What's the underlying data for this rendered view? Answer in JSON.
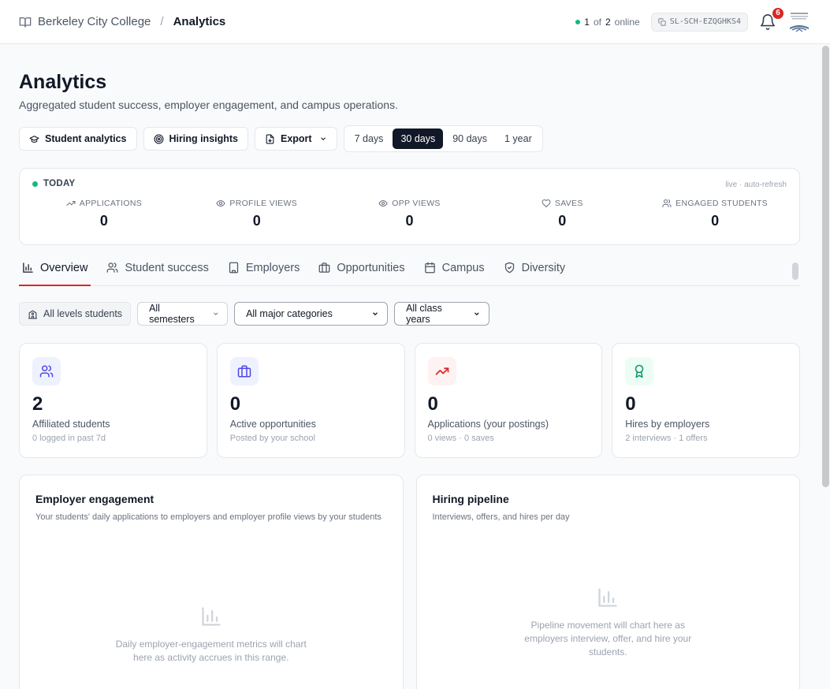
{
  "breadcrumb": {
    "org": "Berkeley City College",
    "separator": "/",
    "current": "Analytics"
  },
  "presence": {
    "count": "1",
    "of": "of",
    "total": "2",
    "label": "online"
  },
  "school_code": "SL-SCH-EZQGHKS4",
  "notifications": {
    "count": "6"
  },
  "page": {
    "title": "Analytics",
    "subtitle": "Aggregated student success, employer engagement, and campus operations."
  },
  "toolbar": {
    "student_analytics": "Student analytics",
    "hiring_insights": "Hiring insights",
    "export": "Export",
    "ranges": [
      "7 days",
      "30 days",
      "90 days",
      "1 year"
    ],
    "selected_range": "30 days"
  },
  "today": {
    "label": "TODAY",
    "live": "live · auto-refresh",
    "metrics": [
      {
        "label": "APPLICATIONS",
        "value": "0",
        "icon": "trending-up-icon"
      },
      {
        "label": "PROFILE VIEWS",
        "value": "0",
        "icon": "eye-icon"
      },
      {
        "label": "OPP VIEWS",
        "value": "0",
        "icon": "eye-icon"
      },
      {
        "label": "SAVES",
        "value": "0",
        "icon": "heart-icon"
      },
      {
        "label": "ENGAGED STUDENTS",
        "value": "0",
        "icon": "users-icon"
      }
    ]
  },
  "tabs": [
    {
      "label": "Overview",
      "icon": "bar-chart-icon",
      "active": true
    },
    {
      "label": "Student success",
      "icon": "users-icon"
    },
    {
      "label": "Employers",
      "icon": "building-icon"
    },
    {
      "label": "Opportunities",
      "icon": "briefcase-icon"
    },
    {
      "label": "Campus",
      "icon": "calendar-icon"
    },
    {
      "label": "Diversity",
      "icon": "shield-icon"
    }
  ],
  "filters": {
    "level": "All levels students",
    "semester": "All semesters",
    "major": "All major categories",
    "class_year": "All class years"
  },
  "stats": [
    {
      "value": "2",
      "title": "Affiliated students",
      "sub": "0 logged in past 7d",
      "icon": "users-icon",
      "color": "#4f46e5",
      "bg": "#eef2ff"
    },
    {
      "value": "0",
      "title": "Active opportunities",
      "sub": "Posted by your school",
      "icon": "briefcase-icon",
      "color": "#4f46e5",
      "bg": "#eef2ff"
    },
    {
      "value": "0",
      "title": "Applications (your postings)",
      "sub": "0 views · 0 saves",
      "icon": "trending-up-icon",
      "color": "#dc2626",
      "bg": "#fef2f2"
    },
    {
      "value": "0",
      "title": "Hires by employers",
      "sub": "2 interviews · 1 offers",
      "icon": "award-icon",
      "color": "#059669",
      "bg": "#ecfdf5"
    }
  ],
  "charts": {
    "engagement": {
      "title": "Employer engagement",
      "desc": "Your students' daily applications to employers and employer profile views by your students",
      "empty": "Daily employer-engagement metrics will chart here as activity accrues in this range."
    },
    "pipeline": {
      "title": "Hiring pipeline",
      "desc": "Interviews, offers, and hires per day",
      "empty": "Pipeline movement will chart here as employers interview, offer, and hire your students."
    }
  }
}
